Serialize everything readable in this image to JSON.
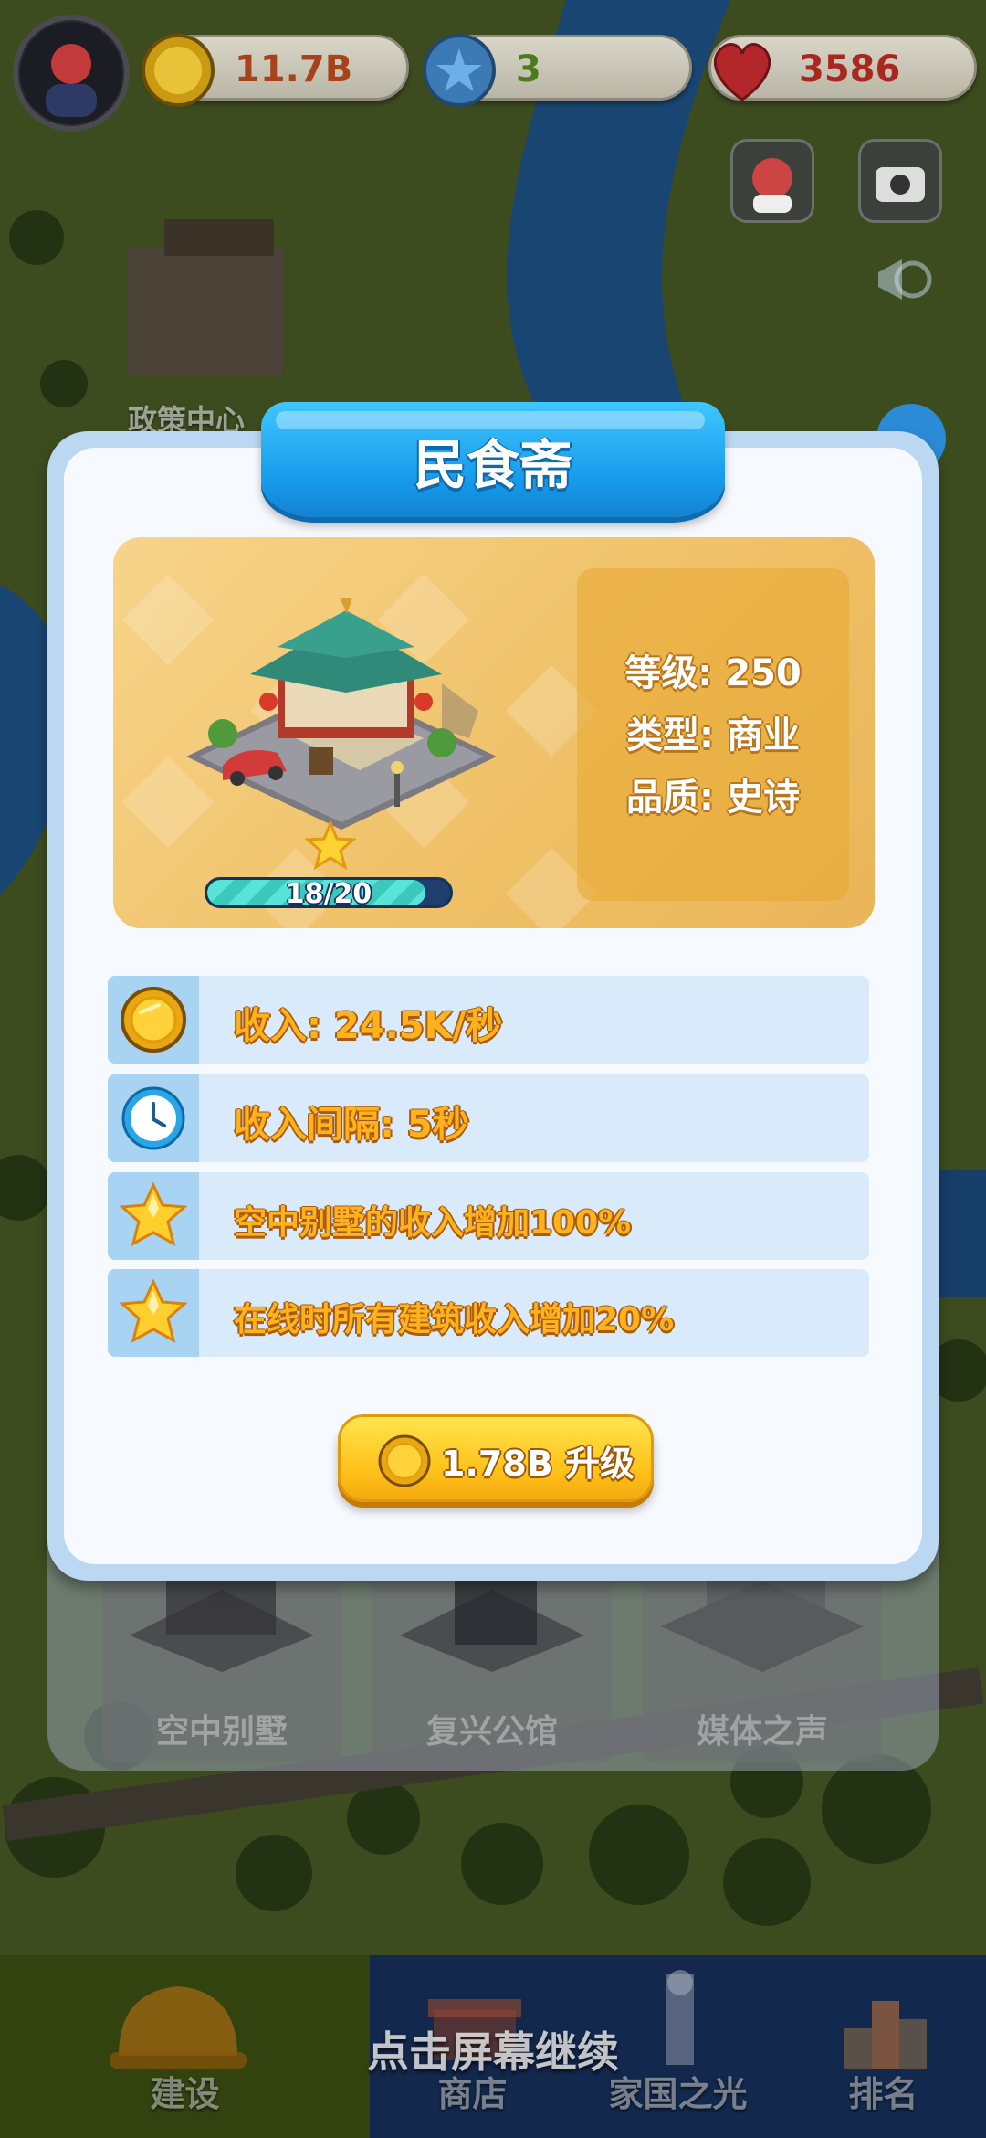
{
  "hud": {
    "coins": "11.7B",
    "stars": "3",
    "hearts": "3586"
  },
  "background": {
    "map_label": "政策中心",
    "buildings": [
      "空中别墅",
      "复兴公馆",
      "媒体之声"
    ]
  },
  "dialog": {
    "title": "民食斋",
    "stats": {
      "level": "等级: 250",
      "type": "类型: 商业",
      "quality": "品质: 史诗"
    },
    "progress": {
      "text": "18/20",
      "current": 18,
      "max": 20
    },
    "attributes": [
      {
        "icon": "coin-icon",
        "text": "收入: 24.5K/秒"
      },
      {
        "icon": "clock-icon",
        "text": "收入间隔: 5秒"
      },
      {
        "icon": "star-icon",
        "text": "空中别墅的收入增加100%"
      },
      {
        "icon": "star-icon",
        "text": "在线时所有建筑收入增加20%"
      }
    ],
    "upgrade": {
      "cost": "1.78B",
      "label": "升级",
      "full": "1.78B 升级"
    }
  },
  "continue_hint": "点击屏幕继续",
  "nav": {
    "tabs": [
      "建设",
      "商店",
      "家国之光",
      "排名"
    ]
  },
  "colors": {
    "banner": "#1699ea",
    "panel": "#efc066",
    "button": "#ffc21a",
    "attr_text": "#ffb21c"
  }
}
